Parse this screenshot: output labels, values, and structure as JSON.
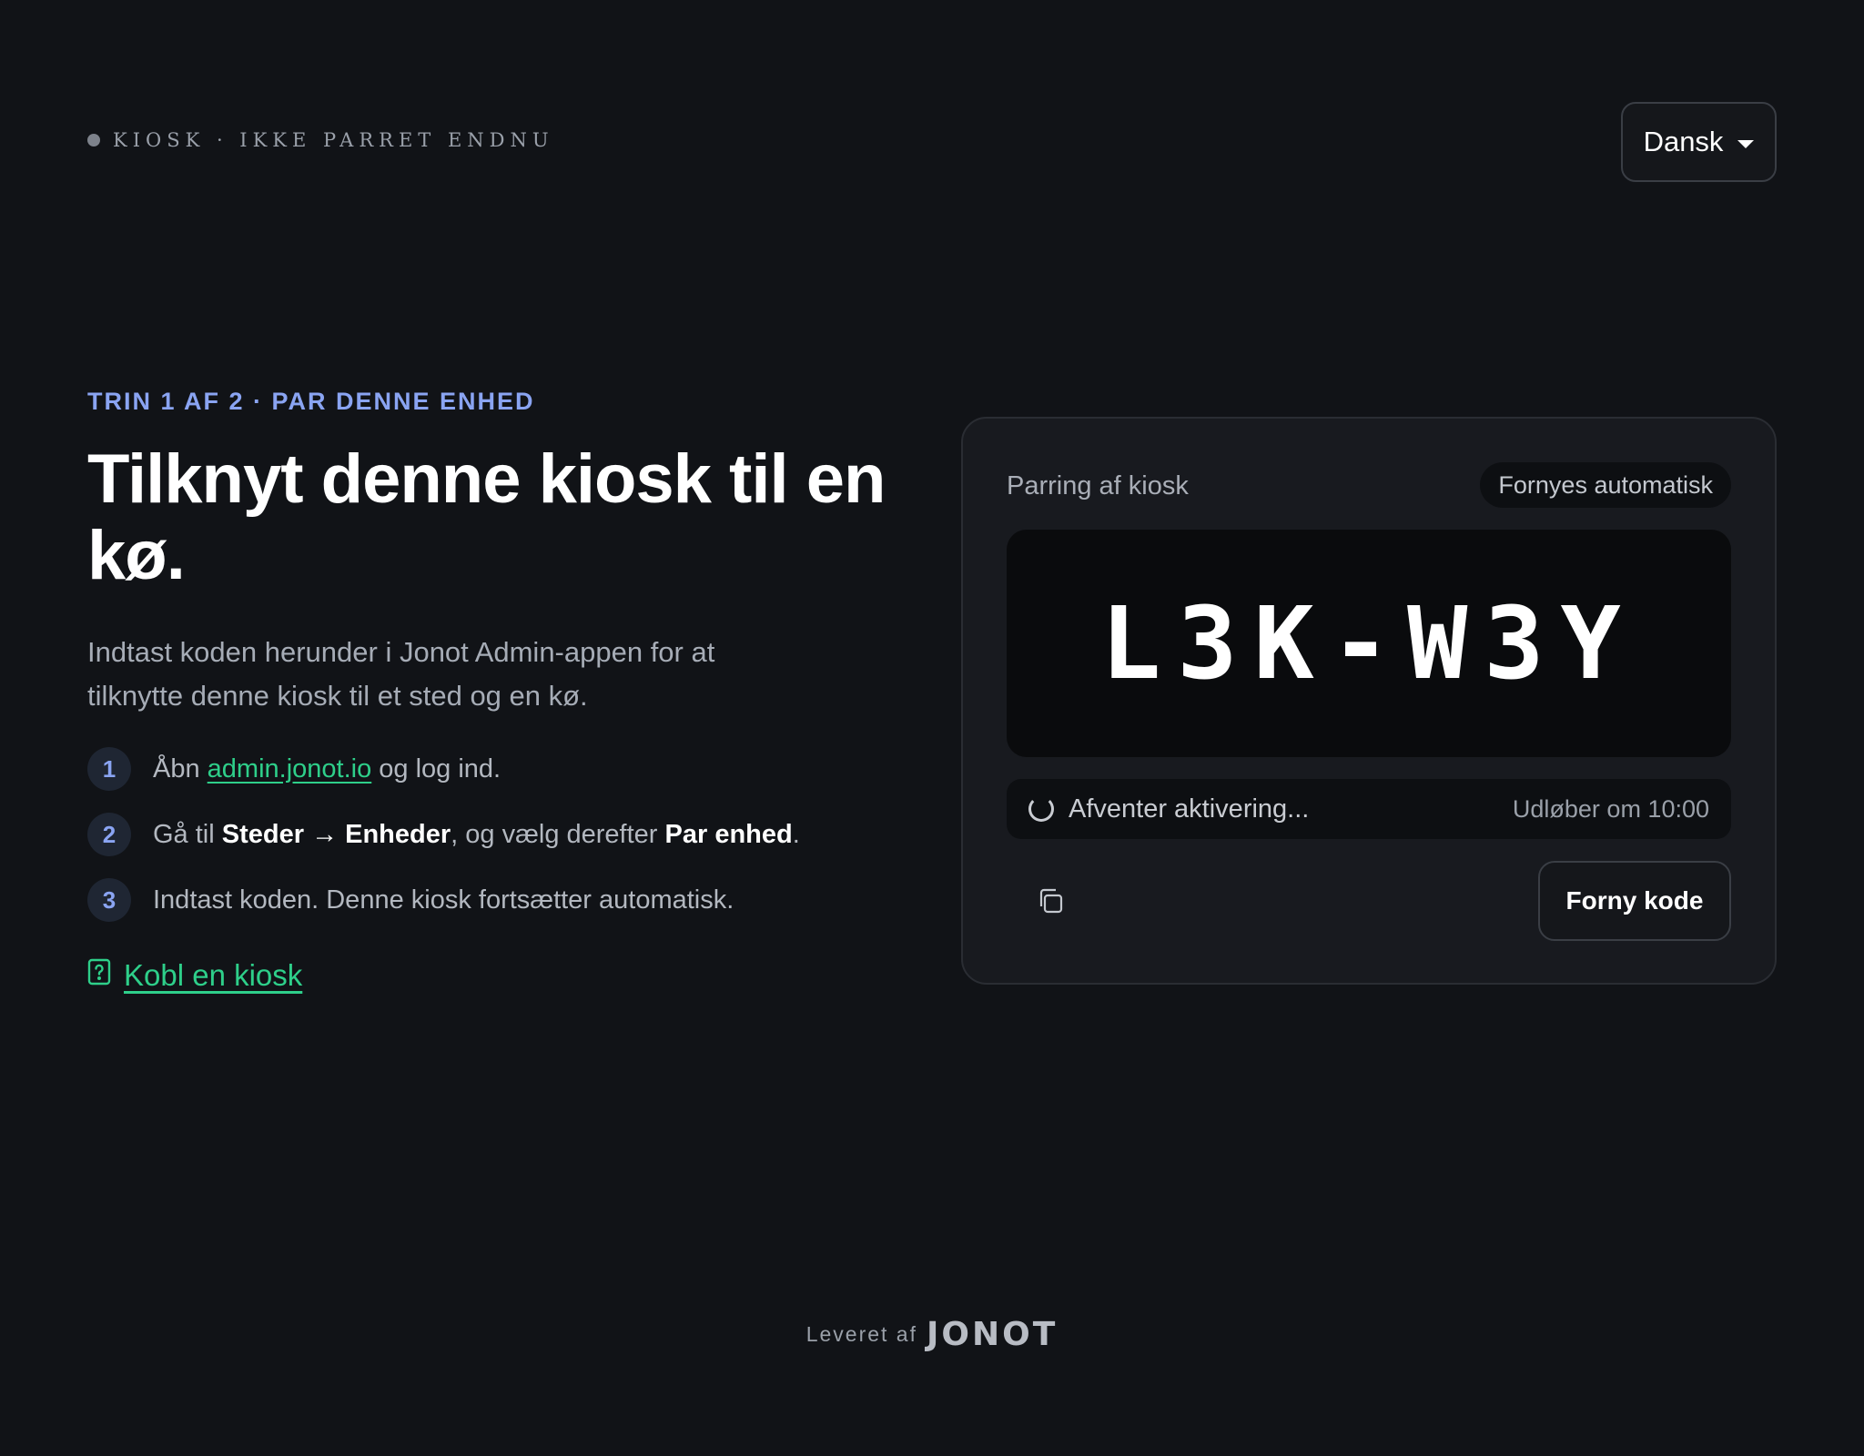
{
  "header": {
    "status_text": "KIOSK · IKKE PARRET ENDNU",
    "language": "Dansk"
  },
  "intro": {
    "step_label": "TRIN 1 AF 2 · PAR DENNE ENHED",
    "title": "Tilknyt denne kiosk til en kø.",
    "description": "Indtast koden herunder i Jonot Admin-appen for at tilknytte denne kiosk til et sted og en kø."
  },
  "steps": [
    {
      "num": "1",
      "pre": "Åbn ",
      "link": "admin.jonot.io",
      "post": " og log ind."
    },
    {
      "num": "2",
      "pre": "Gå til ",
      "b1": "Steder → Enheder",
      "mid": ", og vælg derefter ",
      "b2": "Par enhed",
      "post": "."
    },
    {
      "num": "3",
      "text": "Indtast koden. Denne kiosk fortsætter automatisk."
    }
  ],
  "help_link": "Kobl en kiosk",
  "card": {
    "title": "Parring af kiosk",
    "badge": "Fornyes automatisk",
    "code": "L3K-W3Y",
    "waiting": "Afventer aktivering...",
    "expires": "Udløber om 10:00",
    "renew_label": "Forny kode"
  },
  "footer": {
    "by": "Leveret af",
    "brand": "JONOT"
  },
  "colors": {
    "background": "#111317",
    "accent_blue": "#8aa4f2",
    "accent_green": "#2ecf8a"
  },
  "icons": {
    "copy": "copy-icon",
    "help": "help-document-icon",
    "spinner": "spinner-icon"
  }
}
